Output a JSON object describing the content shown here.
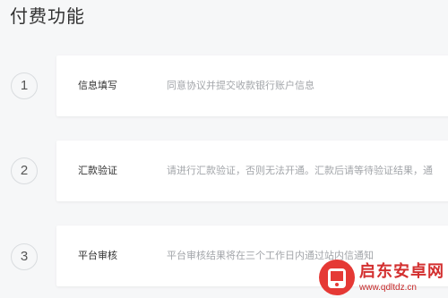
{
  "page": {
    "title": "付费功能"
  },
  "steps": [
    {
      "number": "1",
      "title": "信息填写",
      "description": "同意协议并提交收款银行账户信息"
    },
    {
      "number": "2",
      "title": "汇款验证",
      "description": "请进行汇款验证，否则无法开通。汇款后请等待验证结果，通"
    },
    {
      "number": "3",
      "title": "平台审核",
      "description": "平台审核结果将在三个工作日内通过站内信通知"
    }
  ],
  "watermark": {
    "name": "启东安卓网",
    "url": "www.qdltdz.cn",
    "color": "#d32f2f",
    "icon": "phone-icon"
  },
  "colors": {
    "background": "#f6f7f8",
    "card": "#ffffff",
    "title_text": "#333333",
    "description_text": "#a3a6aa",
    "circle_border": "#d9dcdf"
  }
}
